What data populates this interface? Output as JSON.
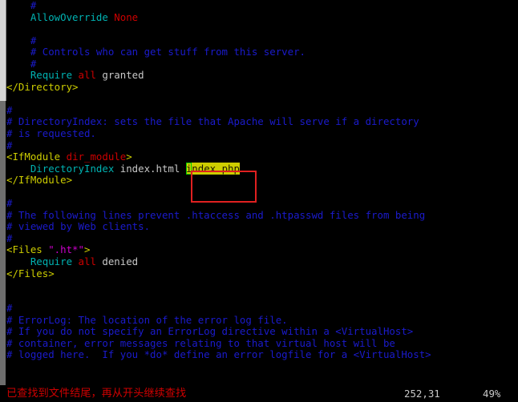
{
  "window": {
    "kind": "terminal-vim-editor",
    "background": "#000000"
  },
  "scrollbar": {
    "name": "vertical-scrollbar",
    "thumb_color": "#d6d6d6",
    "track_color": "#6e6e6e"
  },
  "editor": {
    "lines": [
      [
        {
          "t": "    ",
          "c": "plain"
        },
        {
          "t": "#",
          "c": "comment"
        }
      ],
      [
        {
          "t": "    ",
          "c": "plain"
        },
        {
          "t": "AllowOverride ",
          "c": "key"
        },
        {
          "t": "None",
          "c": "val"
        }
      ],
      [
        {
          "t": "",
          "c": "plain"
        }
      ],
      [
        {
          "t": "    ",
          "c": "plain"
        },
        {
          "t": "#",
          "c": "comment"
        }
      ],
      [
        {
          "t": "    ",
          "c": "plain"
        },
        {
          "t": "# Controls who can get stuff from this server.",
          "c": "comment"
        }
      ],
      [
        {
          "t": "    ",
          "c": "plain"
        },
        {
          "t": "#",
          "c": "comment"
        }
      ],
      [
        {
          "t": "    ",
          "c": "plain"
        },
        {
          "t": "Require ",
          "c": "key"
        },
        {
          "t": "all ",
          "c": "val"
        },
        {
          "t": "granted",
          "c": "plain"
        }
      ],
      [
        {
          "t": "</Directory>",
          "c": "tag"
        }
      ],
      [
        {
          "t": "",
          "c": "plain"
        }
      ],
      [
        {
          "t": "#",
          "c": "comment"
        }
      ],
      [
        {
          "t": "# DirectoryIndex: sets the file that Apache will serve if a directory",
          "c": "comment"
        }
      ],
      [
        {
          "t": "# is requested.",
          "c": "comment"
        }
      ],
      [
        {
          "t": "#",
          "c": "comment"
        }
      ],
      [
        {
          "t": "<IfModule ",
          "c": "tag"
        },
        {
          "t": "dir_module",
          "c": "val"
        },
        {
          "t": ">",
          "c": "tag"
        }
      ],
      [
        {
          "t": "    ",
          "c": "plain"
        },
        {
          "t": "DirectoryIndex ",
          "c": "key"
        },
        {
          "t": "index.html ",
          "c": "plain"
        },
        {
          "t": "i",
          "c": "cursor"
        },
        {
          "t": "ndex.php",
          "c": "hit"
        }
      ],
      [
        {
          "t": "</IfModule>",
          "c": "tag"
        }
      ],
      [
        {
          "t": "",
          "c": "plain"
        }
      ],
      [
        {
          "t": "#",
          "c": "comment"
        }
      ],
      [
        {
          "t": "# The following lines prevent .htaccess and .htpasswd files from being",
          "c": "comment"
        }
      ],
      [
        {
          "t": "# viewed by Web clients.",
          "c": "comment"
        }
      ],
      [
        {
          "t": "#",
          "c": "comment"
        }
      ],
      [
        {
          "t": "<Files ",
          "c": "tag"
        },
        {
          "t": "\".ht*\"",
          "c": "str"
        },
        {
          "t": ">",
          "c": "tag"
        }
      ],
      [
        {
          "t": "    ",
          "c": "plain"
        },
        {
          "t": "Require ",
          "c": "key"
        },
        {
          "t": "all ",
          "c": "val"
        },
        {
          "t": "denied",
          "c": "plain"
        }
      ],
      [
        {
          "t": "</Files>",
          "c": "tag"
        }
      ],
      [
        {
          "t": "",
          "c": "plain"
        }
      ],
      [
        {
          "t": "",
          "c": "plain"
        }
      ],
      [
        {
          "t": "#",
          "c": "comment"
        }
      ],
      [
        {
          "t": "# ErrorLog: The location of the error log file.",
          "c": "comment"
        }
      ],
      [
        {
          "t": "# If you do not specify an ErrorLog directive within a <VirtualHost>",
          "c": "comment"
        }
      ],
      [
        {
          "t": "# container, error messages relating to that virtual host will be",
          "c": "comment"
        }
      ],
      [
        {
          "t": "# logged here.  If you *do* define an error logfile for a <VirtualHost>",
          "c": "comment"
        }
      ]
    ]
  },
  "annotation": {
    "name": "red-highlight-rectangle",
    "color": "#e02020",
    "targets": "index.php"
  },
  "status_bar": {
    "message": "已查找到文件结尾，再从开头继续查找",
    "message_color": "#cd0000",
    "ruler": "252,31",
    "percent": "49%"
  }
}
